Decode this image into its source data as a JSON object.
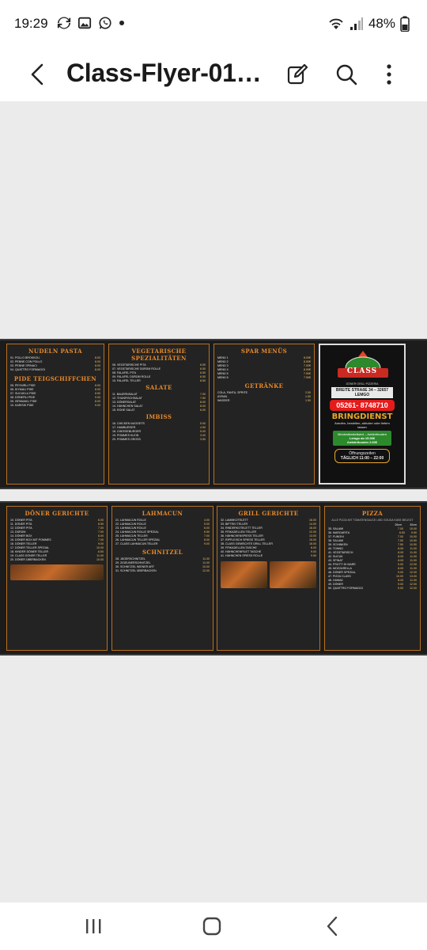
{
  "status": {
    "time": "19:29",
    "battery": "48%",
    "left_icons": [
      "sync-icon",
      "image-icon",
      "whatsapp-icon",
      "dot-icon"
    ],
    "right_icons": [
      "wifi-icon",
      "signal-icon",
      "battery-icon"
    ]
  },
  "appbar": {
    "title": "Class-Flyer-01…",
    "actions": [
      "edit-icon",
      "search-icon",
      "more-icon"
    ]
  },
  "flyer": {
    "top": {
      "panels": [
        {
          "title": "NUDELN PASTA",
          "items": [
            {
              "name": "01. POLLO BROKKOLI",
              "price": "8.00"
            },
            {
              "name": "02. PENNE CON POLLO",
              "price": "8.00"
            },
            {
              "name": "03. PENNE SPINACI",
              "price": "8.00"
            },
            {
              "name": "04. QUATTRO FORMAGGI",
              "price": "8.00"
            }
          ],
          "title2": "PIDE TEIGSCHIFFCHEN",
          "items2": [
            {
              "name": "05. PEYNIRLI PIDE",
              "price": "8.00"
            },
            {
              "name": "06. KIYMALI PIDE",
              "price": "8.00"
            },
            {
              "name": "07. SUCUKLU PIDE",
              "price": "8.50"
            },
            {
              "name": "08. DÖNERLI PIDE",
              "price": "9.00"
            },
            {
              "name": "09. ISPANAKLI PIDE",
              "price": "8.00"
            },
            {
              "name": "10. KARISIK PIDE",
              "price": "9.00"
            }
          ]
        },
        {
          "title": "VEGETARISCHE SPEZIALITÄTEN",
          "items": [
            {
              "name": "06. VEGETARISCHE PITA",
              "price": "6.50"
            },
            {
              "name": "07. VEGETARISCHE DÜRÜM ROLLE",
              "price": "6.50"
            },
            {
              "name": "08. FALAFEL PITA",
              "price": "6.50"
            },
            {
              "name": "09. FALAFEL DÜRÜM ROLLE",
              "price": "6.50"
            },
            {
              "name": "10. FALAFEL TELLER",
              "price": "8.50"
            }
          ],
          "title2": "SALATE",
          "items2": [
            {
              "name": "11. BAUERNSALAT",
              "price": "7.00"
            },
            {
              "name": "12. THUNFISCHSALAT",
              "price": "7.50"
            },
            {
              "name": "13. DÖNERSALAT",
              "price": "8.00"
            },
            {
              "name": "14. HÄHNCHEN SALAT",
              "price": "8.00"
            },
            {
              "name": "15. ROHE SALAT",
              "price": "6.00"
            }
          ],
          "title3": "IMBISS",
          "items3": [
            {
              "name": "16. CHICKEN NUGGETS",
              "price": "5.00"
            },
            {
              "name": "17. HAMBURGER",
              "price": "4.50"
            },
            {
              "name": "18. CHEESEBURGER",
              "price": "5.00"
            },
            {
              "name": "19. POMMES KLEIN",
              "price": "3.00"
            },
            {
              "name": "20. POMMES GROSS",
              "price": "3.50"
            }
          ]
        },
        {
          "title": "SPAR MENÜS",
          "items": [
            {
              "name": "MENÜ 1",
              "price": "8.00€"
            },
            {
              "name": "MENÜ 2",
              "price": "8.50€"
            },
            {
              "name": "MENÜ 3",
              "price": "7.00€"
            },
            {
              "name": "MENÜ 4",
              "price": "8.00€"
            },
            {
              "name": "MENÜ 5",
              "price": "7.50€"
            },
            {
              "name": "MENÜ 6",
              "price": "7.50€"
            }
          ],
          "title2": "GETRÄNKE",
          "items2": [
            {
              "name": "COLA, FANTA, SPRITE",
              "price": "2.50"
            },
            {
              "name": "AYRAN",
              "price": "1.50"
            },
            {
              "name": "WASSER",
              "price": "1.50"
            }
          ]
        }
      ],
      "logo": {
        "brand": "CLASS",
        "tagline": "DÖNER·GRILL·PIZZERIA",
        "address": "BREITE STRAßE 34 – 32657 LEMGO",
        "phone": "05261- 8748710",
        "delivery": "BRINGDIENST",
        "delivery_sub": "Anrufen, bestellen, abholen oder liefern lassen",
        "min_order": "Mindestbestellwert – Anfahrtkosten",
        "min_order_2": "Lemgo ab 15.00€",
        "fee": "Anfahrtkosten 2.00€",
        "hours_label": "Öffnungszeiten",
        "hours": "TÄGLICH 11:00 – 22:00"
      }
    },
    "bottom": {
      "panels": [
        {
          "title": "DÖNER GERICHTE",
          "items": [
            {
              "name": "10. DÖNER PITA",
              "price": "6.00"
            },
            {
              "name": "11. DÖNER PITA",
              "price": "6.50"
            },
            {
              "name": "12. DÖNER PITA",
              "price": "7.00"
            },
            {
              "name": "13. DÜRÜM",
              "price": "7.00"
            },
            {
              "name": "14. DÖNER BOX",
              "price": "6.00"
            },
            {
              "name": "15. DÖNER BOX MIT POMMES",
              "price": "7.00"
            },
            {
              "name": "16. DÖNER TELLER",
              "price": "9.00"
            },
            {
              "name": "17. DÖNER TELLER SPEZIAL",
              "price": "10.00"
            },
            {
              "name": "18. KINDER DÖNER TELLER",
              "price": "6.50"
            },
            {
              "name": "19. CLASS DÖNER TELLER",
              "price": "11.00"
            },
            {
              "name": "20. DÖNER ÜBERBACKEN",
              "price": "10.00"
            }
          ]
        },
        {
          "title": "LAHMACUN",
          "items": [
            {
              "name": "21. LAHMACUN ROLLE",
              "price": "4.00"
            },
            {
              "name": "22. LAHMACUN ROLLE",
              "price": "5.00"
            },
            {
              "name": "23. LAHMACUN ROLLE",
              "price": "6.00"
            },
            {
              "name": "24. LAHMACUN ROLLE SPEZIAL",
              "price": "6.50"
            },
            {
              "name": "25. LAHMACUN TELLER",
              "price": "7.00"
            },
            {
              "name": "26. LAHMACUN TELLER SPEZIAL",
              "price": "8.00"
            },
            {
              "name": "27. CLASS LAHMACUN TELLER",
              "price": "9.00"
            }
          ],
          "title2": "SCHNITZEL",
          "items2": [
            {
              "name": "28. JÄGERSCHNITZEL",
              "price": "11.00"
            },
            {
              "name": "29. ZIGEUNERSCHNITZEL",
              "price": "11.00"
            },
            {
              "name": "30. SCHNITZEL WIENER ART",
              "price": "10.00"
            },
            {
              "name": "31. SCHNITZEL ÜBERBACKEN",
              "price": "12.00"
            }
          ]
        },
        {
          "title": "GRILL GERICHTE",
          "items": [
            {
              "name": "32. LAMMKOTELETT",
              "price": "16.00"
            },
            {
              "name": "33. BIFTEKI TELLER",
              "price": "14.00"
            },
            {
              "name": "34. RINDERKOTELETT TELLER",
              "price": "16.00"
            },
            {
              "name": "35. FRIKADELLEN TELLER",
              "price": "12.00"
            },
            {
              "name": "36. HÄHNCHENSPIESS TELLER",
              "price": "13.00"
            },
            {
              "name": "37. RIPFLEISCH SPIESS TELLER",
              "price": "15.00"
            },
            {
              "name": "38. CLASS GEMISCHTE GRILL TELLER",
              "price": "18.00"
            },
            {
              "name": "39. FRIKADELLEN TASCHE",
              "price": "8.00"
            },
            {
              "name": "40. HÄHNCHENFILET TASCHE",
              "price": "9.00"
            },
            {
              "name": "41. HÄHNCHEN SPIESS ROLLE",
              "price": "9.50"
            }
          ]
        },
        {
          "title": "PIZZA",
          "subtitle": "ALLE PIZZA MIT TOMATENSAUCE UND GOUDA KÄSE BELEGT",
          "size_headers": [
            "26cm",
            "30cm"
          ],
          "items": [
            {
              "name": "35. SALAMI",
              "p1": "7.00",
              "p2": "10.00"
            },
            {
              "name": "36. MARGARITA",
              "p1": "6.50",
              "p2": "9.50"
            },
            {
              "name": "37. FUNGHI",
              "p1": "7.00",
              "p2": "10.00"
            },
            {
              "name": "38. SALAMI",
              "p1": "7.50",
              "p2": "10.50"
            },
            {
              "name": "39. SCHINKEN",
              "p1": "7.50",
              "p2": "10.50"
            },
            {
              "name": "40. TONNO",
              "p1": "8.00",
              "p2": "11.00"
            },
            {
              "name": "41. VEGETARISCH",
              "p1": "8.00",
              "p2": "11.00"
            },
            {
              "name": "42. SUCUK",
              "p1": "8.00",
              "p2": "11.00"
            },
            {
              "name": "43. SPINAT",
              "p1": "8.00",
              "p2": "11.00"
            },
            {
              "name": "44. FRUTTI DI MARE",
              "p1": "9.00",
              "p2": "12.00"
            },
            {
              "name": "45. MOZZARELLA",
              "p1": "8.00",
              "p2": "11.00"
            },
            {
              "name": "46. DÖNER SPEZIAL",
              "p1": "9.00",
              "p2": "12.00"
            },
            {
              "name": "47. PIZZA CLASS",
              "p1": "10.00",
              "p2": "13.00"
            },
            {
              "name": "48. HAWAII",
              "p1": "8.00",
              "p2": "11.00"
            },
            {
              "name": "49. DÖNER",
              "p1": "9.00",
              "p2": "12.00"
            },
            {
              "name": "50. QUATTRO FORMAGGI",
              "p1": "9.00",
              "p2": "12.00"
            }
          ]
        }
      ]
    }
  },
  "navbar": {
    "buttons": [
      "recents-icon",
      "home-icon",
      "back-nav-icon"
    ]
  },
  "colors": {
    "accent": "#e8892a",
    "price": "#f4c46a",
    "phone_red": "#e51b1b",
    "green": "#2c8a2c"
  }
}
